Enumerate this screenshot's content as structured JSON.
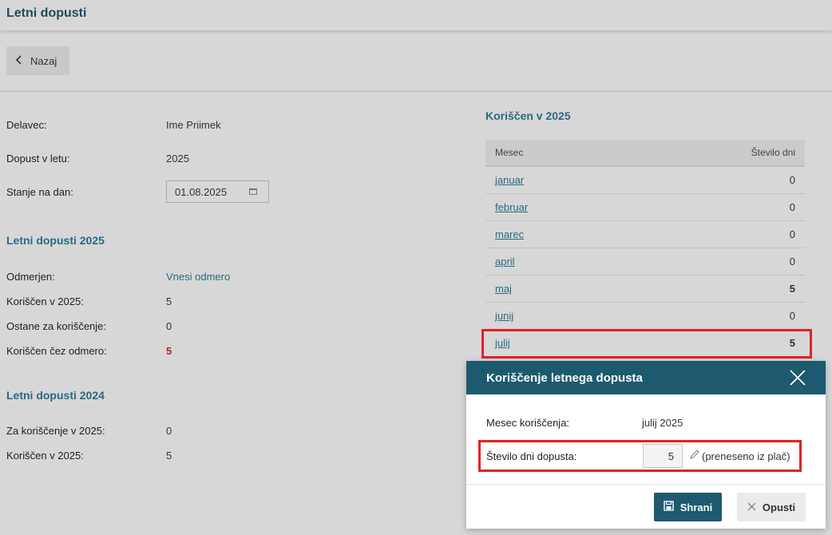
{
  "page": {
    "title": "Letni dopusti",
    "back_label": "Nazaj"
  },
  "info": {
    "delavec_label": "Delavec:",
    "delavec_value": "Ime Priimek",
    "dopust_label": "Dopust v letu:",
    "dopust_value": "2025",
    "stanje_label": "Stanje na dan:",
    "stanje_value": "01.08.2025"
  },
  "section2025": {
    "title": "Letni dopusti 2025",
    "odmerjen_label": "Odmerjen:",
    "odmerjen_value": "Vnesi odmero",
    "koriscen_label": "Koriščen v 2025:",
    "koriscen_value": "5",
    "ostane_label": "Ostane za koriščenje:",
    "ostane_value": "0",
    "cez_label": "Koriščen čez odmero:",
    "cez_value": "5"
  },
  "section2024": {
    "title": "Letni dopusti 2024",
    "za_label": "Za koriščenje v 2025:",
    "za_value": "0",
    "koriscen_label": "Koriščen v 2025:",
    "koriscen_value": "5"
  },
  "usage": {
    "title": "Koriščen v 2025",
    "col_month": "Mesec",
    "col_days": "Število dni",
    "rows": [
      {
        "month": "januar",
        "days": "0"
      },
      {
        "month": "februar",
        "days": "0"
      },
      {
        "month": "marec",
        "days": "0"
      },
      {
        "month": "april",
        "days": "0"
      },
      {
        "month": "maj",
        "days": "5"
      },
      {
        "month": "junij",
        "days": "0"
      },
      {
        "month": "julij",
        "days": "5"
      }
    ]
  },
  "modal": {
    "title": "Koriščenje letnega dopusta",
    "mesec_label": "Mesec koriščenja:",
    "mesec_value": "julij 2025",
    "stevilo_label": "Število dni dopusta:",
    "stevilo_value": "5",
    "note": "(preneseno iz plač)",
    "save_label": "Shrani",
    "cancel_label": "Opusti"
  },
  "colors": {
    "accent": "#1d5a70",
    "link": "#2b6a82",
    "highlight": "#e3202b",
    "warning_value": "#b22222"
  }
}
